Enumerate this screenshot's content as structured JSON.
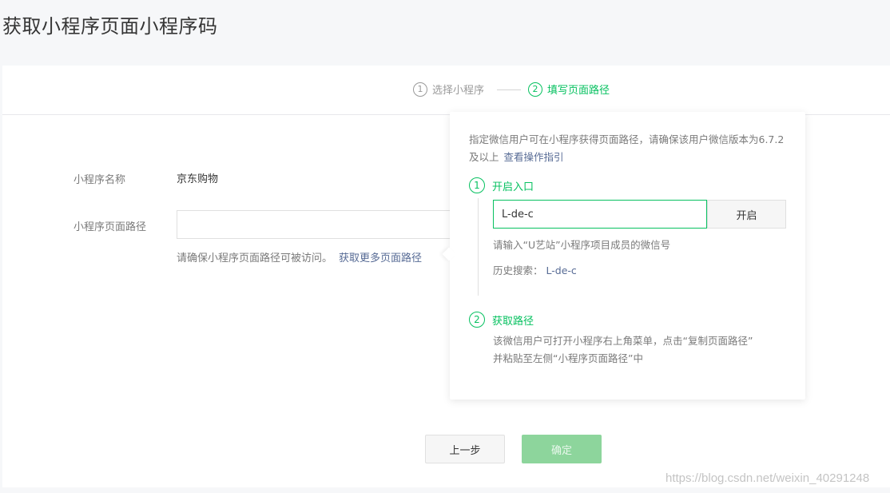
{
  "page": {
    "title": "获取小程序页面小程序码"
  },
  "steps": [
    {
      "num": "1",
      "label": "选择小程序"
    },
    {
      "num": "2",
      "label": "填写页面路径"
    }
  ],
  "form": {
    "name_label": "小程序名称",
    "name_value": "京东购物",
    "path_label": "小程序页面路径",
    "path_value": "",
    "hint": "请确保小程序页面路径可被访问。",
    "hint_link": "获取更多页面路径"
  },
  "popover": {
    "desc": "指定微信用户可在小程序获得页面路径，请确保该用户微信版本为6.7.2及以上",
    "desc_link": "查看操作指引",
    "step1_num": "1",
    "step1_label": "开启入口",
    "wechat_id_value": "L-de-c",
    "open_button": "开启",
    "input_hint": "请输入“U艺站”小程序项目成员的微信号",
    "history_label": "历史搜索：",
    "history_value": "L-de-c",
    "step2_num": "2",
    "step2_label": "获取路径",
    "step2_text_line1": "该微信用户可打开小程序右上角菜单，点击“复制页面路径”",
    "step2_text_line2": "并粘贴至左侧“小程序页面路径”中"
  },
  "buttons": {
    "prev": "上一步",
    "confirm": "确定"
  },
  "watermark": "https://blog.csdn.net/weixin_40291248",
  "colors": {
    "accent": "#07c160",
    "link": "#576b95",
    "confirm_disabled": "#8dd59c"
  }
}
